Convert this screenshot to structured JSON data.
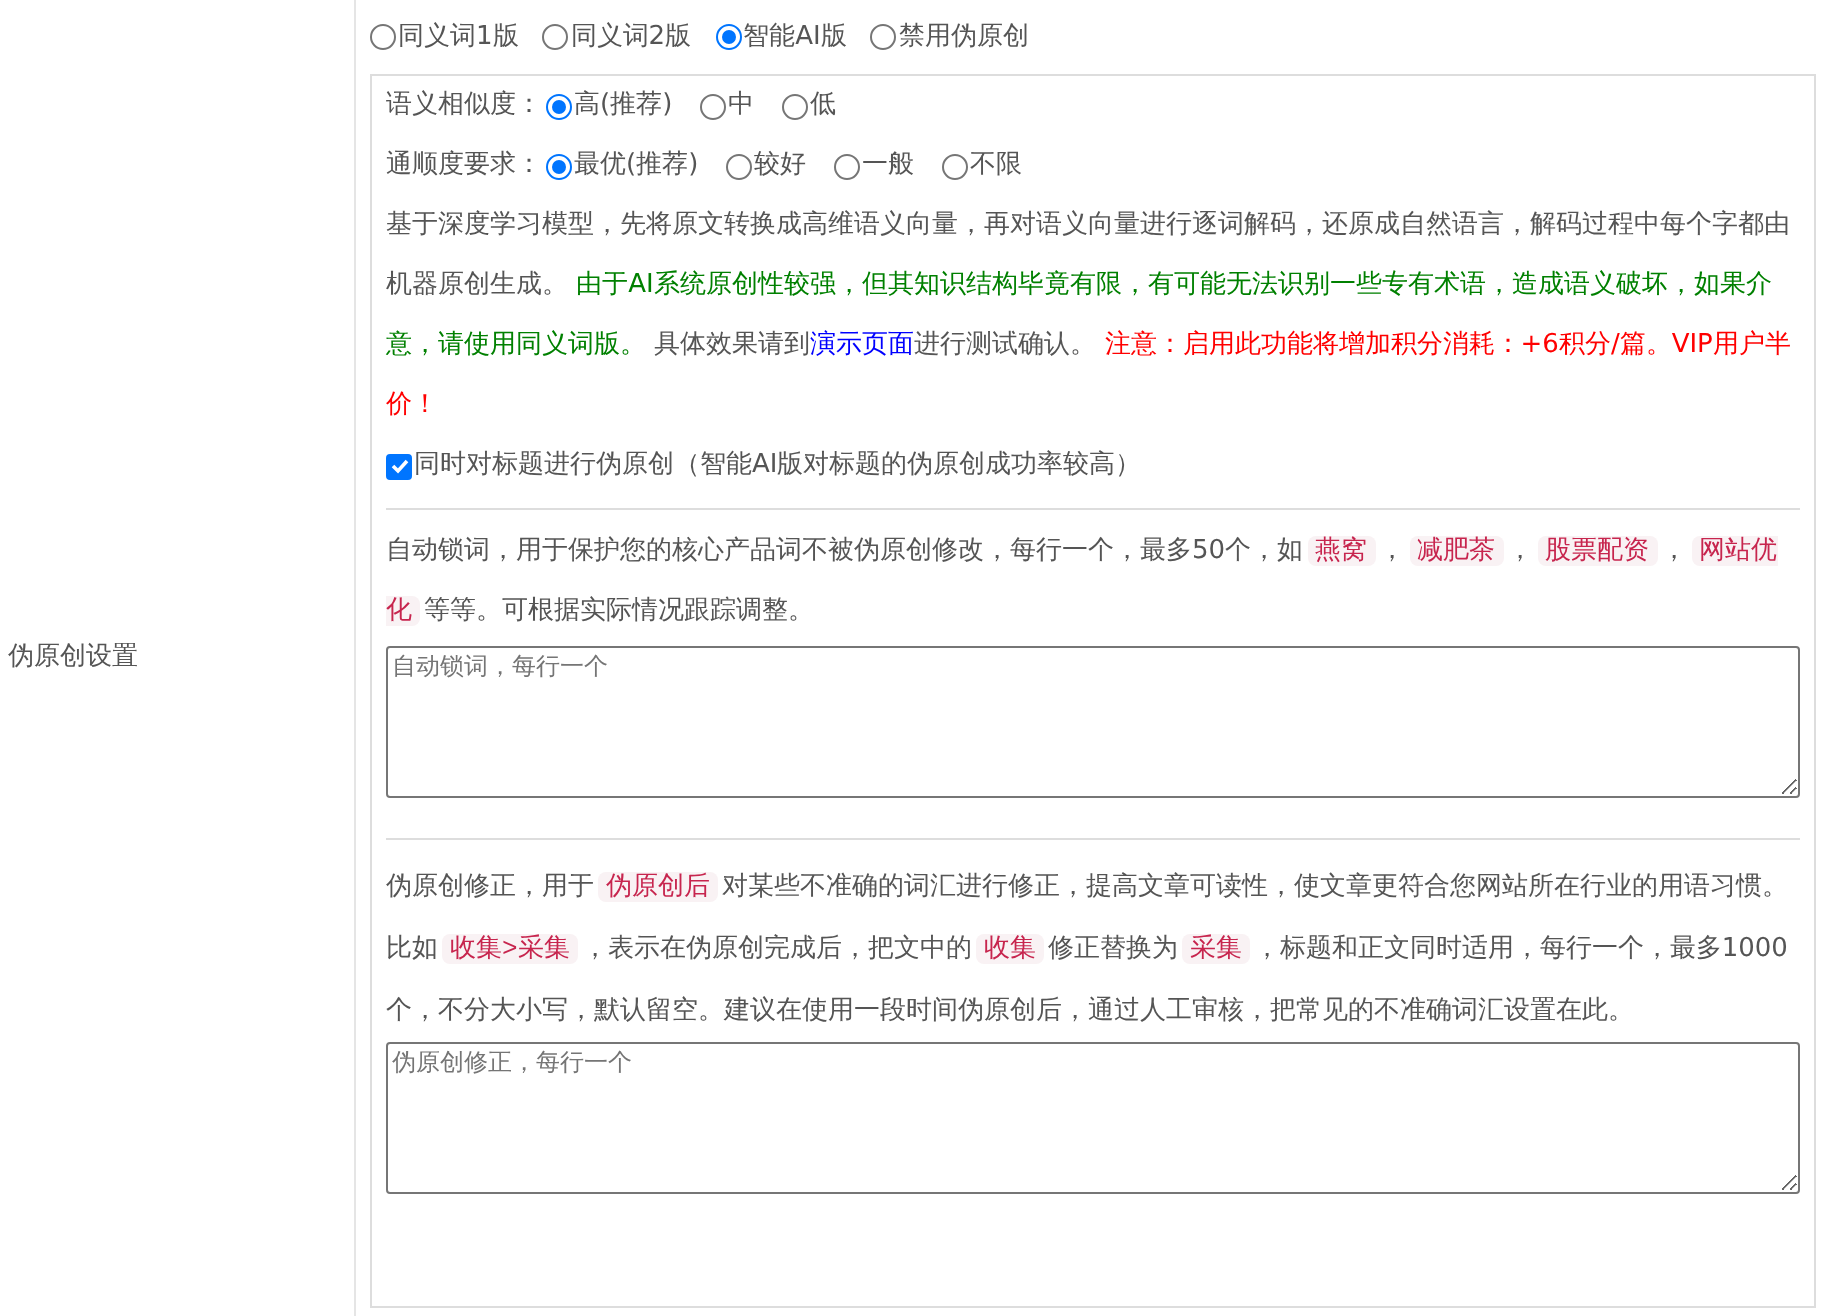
{
  "setting_label": "伪原创设置",
  "modes": [
    {
      "label": "同义词1版",
      "selected": false
    },
    {
      "label": "同义词2版",
      "selected": false
    },
    {
      "label": "智能AI版",
      "selected": true
    },
    {
      "label": "禁用伪原创",
      "selected": false
    }
  ],
  "option_groups": [
    {
      "label": "语义相似度：",
      "options": [
        {
          "label": "高(推荐)",
          "selected": true
        },
        {
          "label": "中",
          "selected": false
        },
        {
          "label": "低",
          "selected": false
        }
      ]
    },
    {
      "label": "通顺度要求：",
      "options": [
        {
          "label": "最优(推荐)",
          "selected": true
        },
        {
          "label": "较好",
          "selected": false
        },
        {
          "label": "一般",
          "selected": false
        },
        {
          "label": "不限",
          "selected": false
        }
      ]
    }
  ],
  "ai_description": [
    {
      "kind": "plain",
      "text": "基于深度学习模型，先将原文转换成高维语义向量，再对语义向量进行逐词解码，还原成自然语言，解码过程中每个字都由机器原创生成。 "
    },
    {
      "kind": "green",
      "text": "由于AI系统原创性较强，但其知识结构毕竟有限，有可能无法识别一些专有术语，造成语义破坏，如果介意，请使用同义词版。"
    },
    {
      "kind": "plain",
      "text": " 具体效果请到"
    },
    {
      "kind": "link",
      "text": "演示页面"
    },
    {
      "kind": "plain",
      "text": "进行测试确认。 "
    },
    {
      "kind": "red",
      "text": "注意：启用此功能将增加积分消耗：+6积分/篇。VIP用户半价！"
    }
  ],
  "title_option": {
    "label": "同时对标题进行伪原创（智能AI版对标题的伪原创成功率较高）",
    "checked": true
  },
  "lock_words": {
    "description": [
      {
        "kind": "plain",
        "text": "自动锁词，用于保护您的核心产品词不被伪原创修改，每行一个，最多50个，如"
      },
      {
        "kind": "code",
        "text": "燕窝"
      },
      {
        "kind": "plain",
        "text": "，"
      },
      {
        "kind": "code",
        "text": "减肥茶"
      },
      {
        "kind": "plain",
        "text": "，"
      },
      {
        "kind": "code",
        "text": "股票配资"
      },
      {
        "kind": "plain",
        "text": "，"
      },
      {
        "kind": "code",
        "text": "网站优化"
      },
      {
        "kind": "plain",
        "text": "等等。可根据实际情况跟踪调整。"
      }
    ],
    "placeholder": "自动锁词，每行一个"
  },
  "corrections": {
    "description": [
      {
        "kind": "plain",
        "text": "伪原创修正，用于"
      },
      {
        "kind": "code",
        "text": "伪原创后"
      },
      {
        "kind": "plain",
        "text": "对某些不准确的词汇进行修正，提高文章可读性，使文章更符合您网站所在行业的用语习惯。比如"
      },
      {
        "kind": "code",
        "text": "收集>采集"
      },
      {
        "kind": "plain",
        "text": "，表示在伪原创完成后，把文中的"
      },
      {
        "kind": "code",
        "text": "收集"
      },
      {
        "kind": "plain",
        "text": "修正替换为"
      },
      {
        "kind": "code",
        "text": "采集"
      },
      {
        "kind": "plain",
        "text": "，标题和正文同时适用，每行一个，最多1000个，不分大小写，默认留空。建议在使用一段时间伪原创后，通过人工审核，把常见的不准确词汇设置在此。"
      }
    ],
    "placeholder": "伪原创修正，每行一个"
  }
}
